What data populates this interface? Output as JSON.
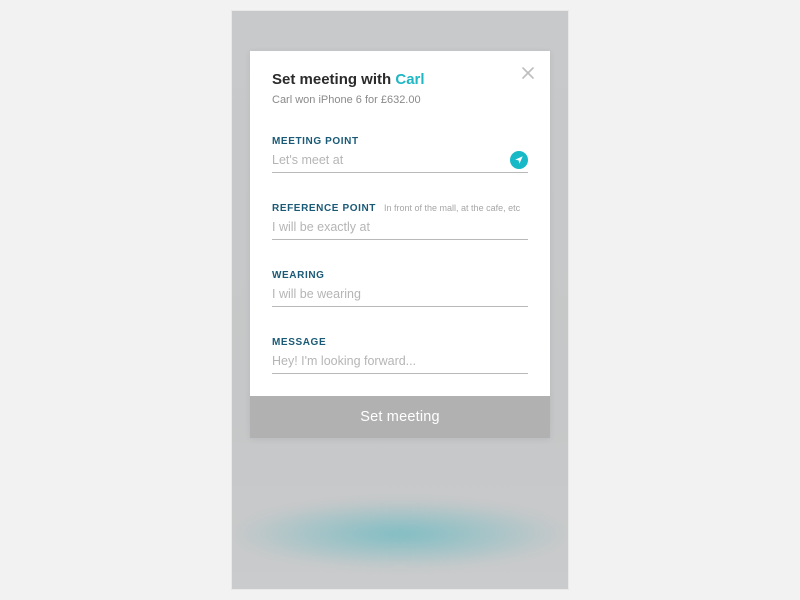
{
  "header": {
    "title_prefix": "Set meeting with ",
    "title_name": "Carl",
    "subtitle": "Carl won iPhone 6 for £632.00"
  },
  "fields": {
    "meeting_point": {
      "label": "MEETING POINT",
      "placeholder": "Let's meet at"
    },
    "reference_point": {
      "label": "REFERENCE POINT",
      "hint": "In front of the mall, at the cafe, etc",
      "placeholder": "I will be exactly at"
    },
    "wearing": {
      "label": "WEARING",
      "placeholder": "I will be wearing"
    },
    "message": {
      "label": "MESSAGE",
      "placeholder": "Hey! I'm looking forward..."
    }
  },
  "submit_label": "Set meeting",
  "colors": {
    "accent": "#17b9c6",
    "label": "#1a5a76"
  }
}
